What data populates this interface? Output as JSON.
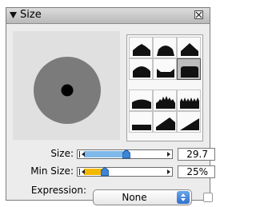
{
  "panel": {
    "title": "Size",
    "icons": {
      "collapse": "disclosure-triangle-down-icon",
      "close": "close-box-icon"
    }
  },
  "presets": [
    {
      "name": "brush-tip-preset-1",
      "selected": false
    },
    {
      "name": "brush-tip-preset-2",
      "selected": false
    },
    {
      "name": "brush-tip-preset-3",
      "selected": false
    },
    {
      "name": "brush-tip-preset-4",
      "selected": false
    },
    {
      "name": "brush-tip-preset-5",
      "selected": false
    },
    {
      "name": "brush-tip-preset-6",
      "selected": true
    },
    {
      "name": "brush-tip-preset-7",
      "selected": false
    },
    {
      "name": "brush-tip-preset-8",
      "selected": false
    },
    {
      "name": "brush-tip-preset-9",
      "selected": false
    },
    {
      "name": "brush-tip-preset-10",
      "selected": false
    },
    {
      "name": "brush-tip-preset-11",
      "selected": false
    },
    {
      "name": "brush-tip-preset-12",
      "selected": false
    }
  ],
  "size": {
    "label": "Size:",
    "value": "29.7",
    "fraction": 0.52,
    "color": "#7fb9ea"
  },
  "min_size": {
    "label": "Min Size:",
    "value": "25%",
    "fraction": 0.25,
    "color": "#f5b800"
  },
  "expression": {
    "label": "Expression:",
    "value": "None",
    "checked": false
  },
  "colors": {
    "accent": "#2f6fd0",
    "thumb": "#3c86d8"
  }
}
